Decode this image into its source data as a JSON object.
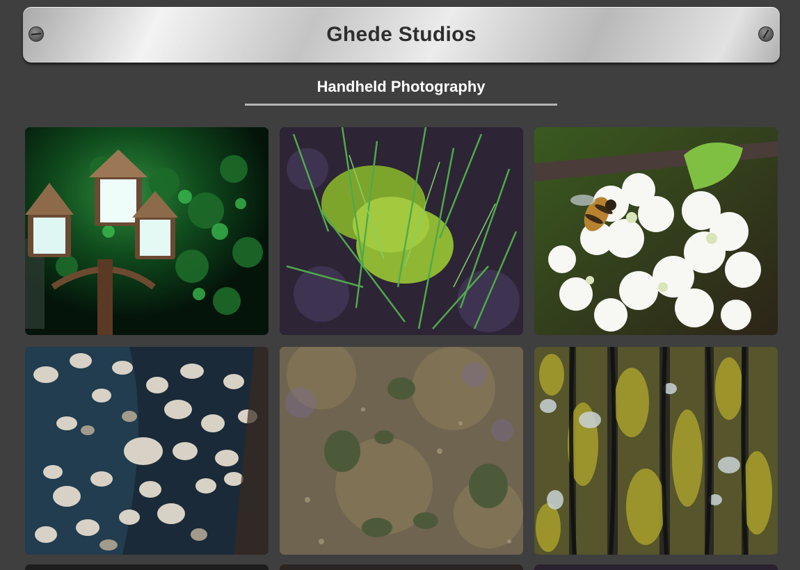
{
  "header": {
    "title": "Ghede Studios"
  },
  "section": {
    "subtitle": "Handheld Photography"
  },
  "gallery": {
    "photos": [
      {
        "icon": "street-lamp-photo"
      },
      {
        "icon": "moss-grass-photo"
      },
      {
        "icon": "bee-blossom-photo"
      },
      {
        "icon": "stream-rocks-photo"
      },
      {
        "icon": "riverbed-photo"
      },
      {
        "icon": "lichen-bark-photo"
      }
    ]
  },
  "colors": {
    "background": "#3f3f3f",
    "plate_light": "#f3f3f3",
    "plate_dark": "#a9a9a9",
    "title_text": "#2e2e2e",
    "subtitle_text": "#ffffff",
    "rule": "#b5b5b5"
  }
}
